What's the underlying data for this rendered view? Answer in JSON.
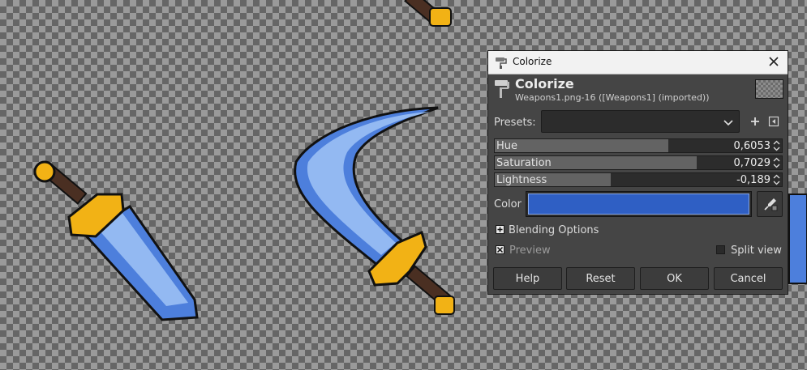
{
  "window": {
    "title": "Colorize"
  },
  "header": {
    "title": "Colorize",
    "subtitle": "Weapons1.png-16 ([Weapons1] (imported))"
  },
  "presets": {
    "label": "Presets:",
    "value": ""
  },
  "sliders": {
    "hue": {
      "label": "Hue",
      "value": "0,6053",
      "fraction": 0.6053
    },
    "saturation": {
      "label": "Saturation",
      "value": "0,7029",
      "fraction": 0.7029
    },
    "lightness": {
      "label": "Lightness",
      "value": "-0,189",
      "fraction": 0.405
    }
  },
  "color": {
    "label": "Color",
    "hex": "#2f5fc4"
  },
  "blending": {
    "label": "Blending Options"
  },
  "preview": {
    "label": "Preview",
    "checked": true
  },
  "split_view": {
    "label": "Split view",
    "checked": false
  },
  "buttons": {
    "help": "Help",
    "reset": "Reset",
    "ok": "OK",
    "cancel": "Cancel"
  },
  "icons": {
    "title": "paint-roller-icon",
    "header": "colorize-tool-icon",
    "close": "close-icon",
    "dropdown": "chevron-down-icon",
    "add_preset": "plus-icon",
    "preset_menu": "menu-arrow-icon",
    "color_picker": "eyedropper-icon",
    "blending": "expander-icon",
    "preview_check": "x-check-icon"
  },
  "colors": {
    "blade": "#4d7fdc",
    "blade_light": "#93b9f2",
    "guard": "#f2b215",
    "handle": "#4a2f22"
  }
}
